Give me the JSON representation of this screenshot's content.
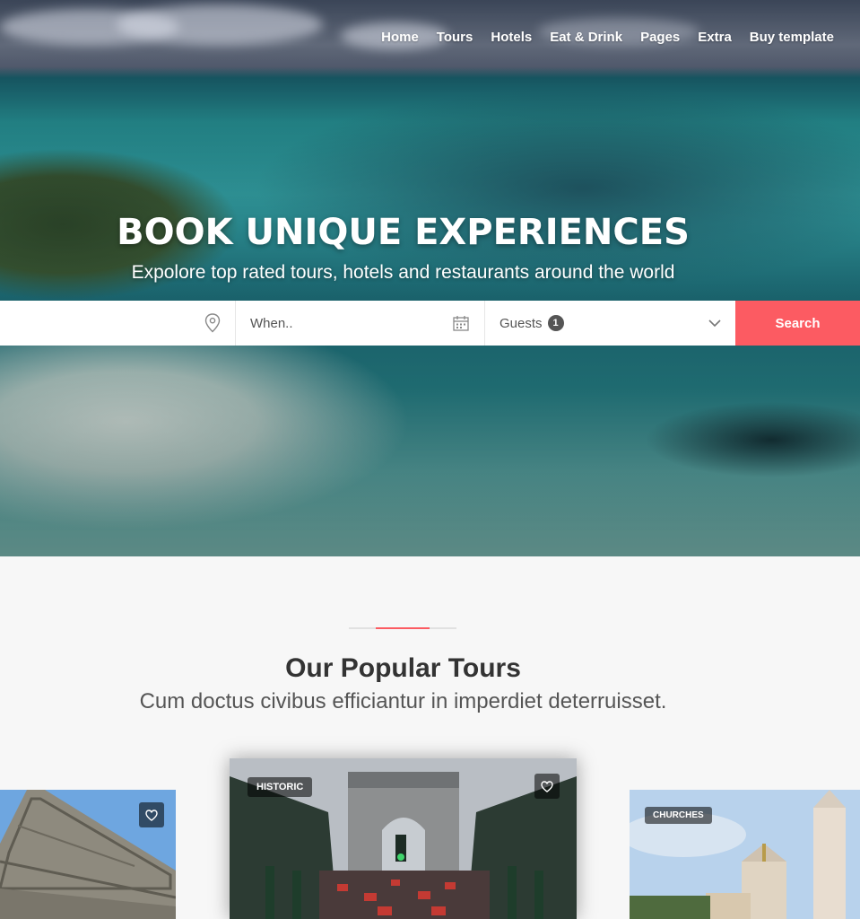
{
  "nav": {
    "items": [
      "Home",
      "Tours",
      "Hotels",
      "Eat & Drink",
      "Pages",
      "Extra",
      "Buy template"
    ]
  },
  "hero": {
    "title": "BOOK UNIQUE EXPERIENCES",
    "subtitle": "Expolore top rated tours, hotels and restaurants around the world"
  },
  "search": {
    "where_placeholder": "",
    "when_placeholder": "When..",
    "guests_label": "Guests",
    "guests_count": "1",
    "button_label": "Search"
  },
  "section": {
    "title": "Our Popular Tours",
    "subtitle": "Cum doctus civibus efficiantur in imperdiet deterruisset."
  },
  "cards": [
    {
      "tag": "",
      "has_heart": true
    },
    {
      "tag": "HISTORIC",
      "has_heart": true
    },
    {
      "tag": "CHURCHES",
      "has_heart": false
    }
  ],
  "colors": {
    "accent": "#fc5b62",
    "search_bar_bg": "#ffffff",
    "page_bg": "#f7f7f7"
  },
  "icons": {
    "location": "map-pin-icon",
    "calendar": "calendar-icon",
    "chevron": "chevron-down-icon",
    "favorite": "heart-icon"
  }
}
